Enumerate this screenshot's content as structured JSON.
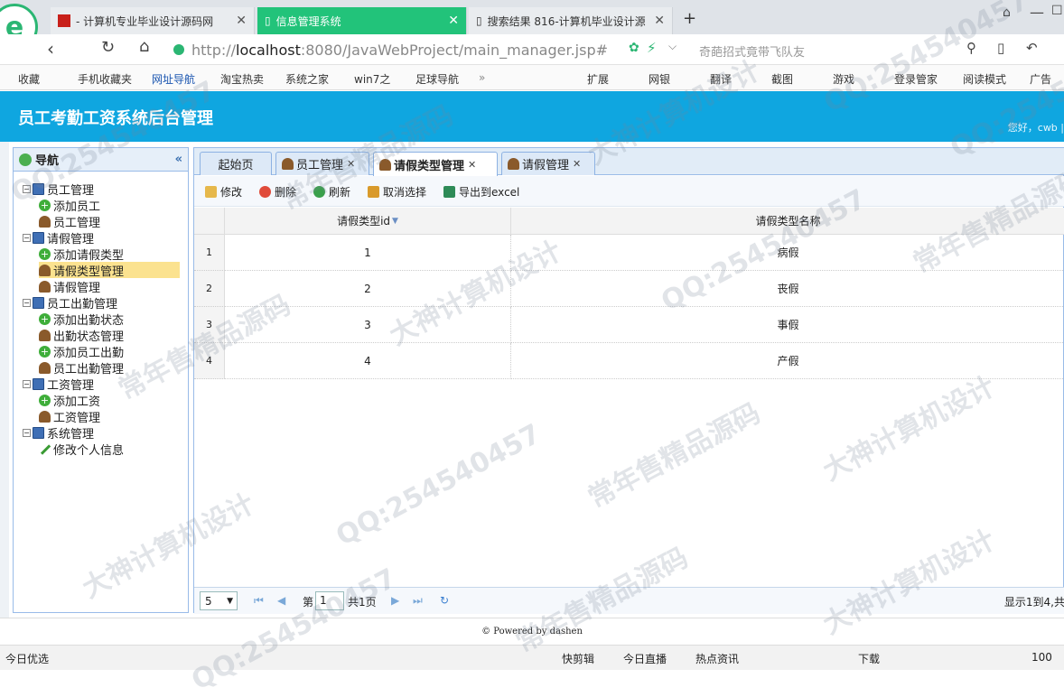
{
  "browser": {
    "tabs": [
      {
        "label": "- 计算机专业毕业设计源码网"
      },
      {
        "label": "信息管理系统"
      },
      {
        "label": "搜索结果 816-计算机毕业设计源"
      }
    ],
    "url_prefix": "http://",
    "url_host": "localhost",
    "url_rest": ":8080/JavaWebProject/main_manager.jsp#",
    "search_placeholder": "奇葩招式竟带飞队友",
    "bookmarks": [
      "收藏",
      "手机收藏夹",
      "网址导航",
      "淘宝热卖",
      "系统之家",
      "win7之",
      "足球导航"
    ],
    "tools": [
      "扩展",
      "网银",
      "翻译",
      "截图",
      "游戏",
      "登录管家",
      "阅读模式",
      "广告"
    ]
  },
  "app": {
    "title": "员工考勤工资系统后台管理",
    "greeting": "您好，cwb |"
  },
  "nav": {
    "header": "导航",
    "tree": [
      {
        "label": "员工管理"
      },
      {
        "label": "添加员工"
      },
      {
        "label": "员工管理"
      },
      {
        "label": "请假管理"
      },
      {
        "label": "添加请假类型"
      },
      {
        "label": "请假类型管理"
      },
      {
        "label": "请假管理"
      },
      {
        "label": "员工出勤管理"
      },
      {
        "label": "添加出勤状态"
      },
      {
        "label": "出勤状态管理"
      },
      {
        "label": "添加员工出勤"
      },
      {
        "label": "员工出勤管理"
      },
      {
        "label": "工资管理"
      },
      {
        "label": "添加工资"
      },
      {
        "label": "工资管理"
      },
      {
        "label": "系统管理"
      },
      {
        "label": "修改个人信息"
      }
    ]
  },
  "tabs": [
    "起始页",
    "员工管理",
    "请假类型管理",
    "请假管理"
  ],
  "toolbar": {
    "edit": "修改",
    "delete": "删除",
    "refresh": "刷新",
    "cancel": "取消选择",
    "export": "导出到excel"
  },
  "grid": {
    "columns": [
      "请假类型id",
      "请假类型名称"
    ],
    "rows": [
      {
        "num": "1",
        "id": "1",
        "name": "病假"
      },
      {
        "num": "2",
        "id": "2",
        "name": "丧假"
      },
      {
        "num": "3",
        "id": "3",
        "name": "事假"
      },
      {
        "num": "4",
        "id": "4",
        "name": "产假"
      }
    ]
  },
  "pager": {
    "page_size": "5",
    "page_prefix": "第",
    "page": "1",
    "total": "共1页",
    "info": "显示1到4,共"
  },
  "footer": "© Powered by dashen",
  "status": {
    "left": "今日优选",
    "items": [
      "快剪辑",
      "今日直播",
      "热点资讯",
      "下载",
      "100"
    ]
  },
  "watermarks": [
    "QQ:254540457",
    "常年售精品源码",
    "大神计算机设计"
  ]
}
